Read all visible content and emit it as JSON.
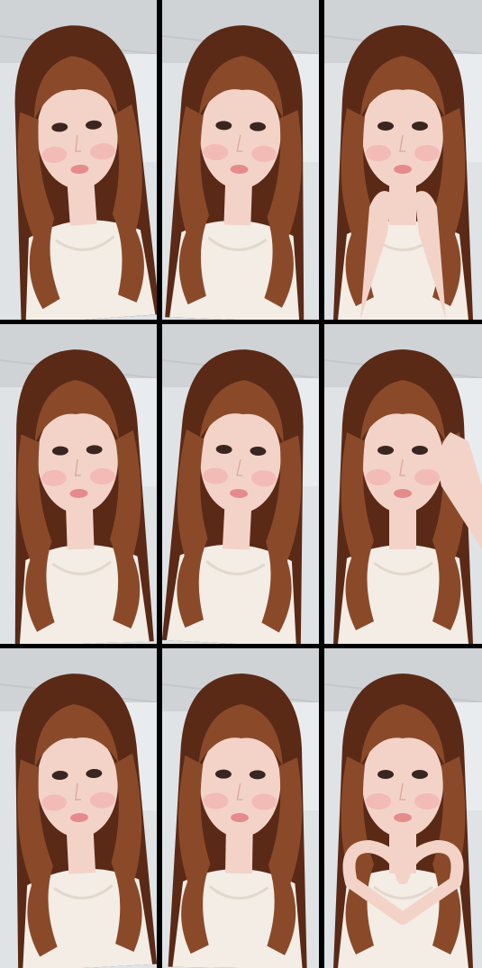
{
  "colors": {
    "background": "#000000",
    "wall": "#dfe3e6",
    "ceiling": "#cfd3d6",
    "hair_dark": "#5a2a17",
    "hair_light": "#8a4a2a",
    "skin": "#f3d3c8",
    "blush": "#f2a7a7",
    "lips": "#e58b8b",
    "blouse": "#f3ede6"
  },
  "frames": [
    {
      "hands": "none",
      "tilt": -4
    },
    {
      "hands": "none",
      "tilt": 2
    },
    {
      "hands": "chin",
      "tilt": 0
    },
    {
      "hands": "none",
      "tilt": -2
    },
    {
      "hands": "none",
      "tilt": 3
    },
    {
      "hands": "hair",
      "tilt": 0
    },
    {
      "hands": "none",
      "tilt": -3
    },
    {
      "hands": "none",
      "tilt": 1
    },
    {
      "hands": "heart",
      "tilt": 0
    }
  ]
}
